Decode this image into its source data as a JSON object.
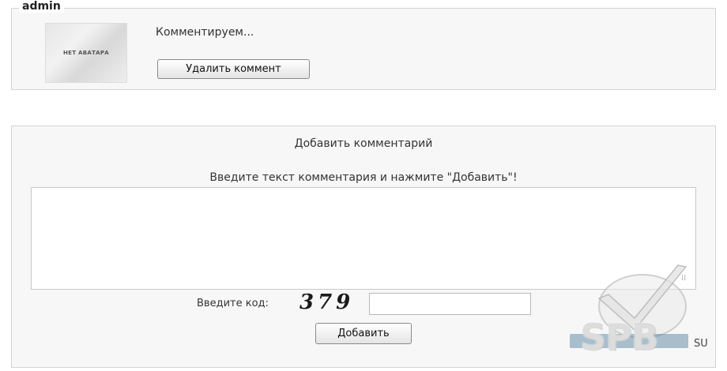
{
  "comment": {
    "author": "admin",
    "avatar_text": "НЕТ АВАТАРА",
    "text": "Комментируем...",
    "delete_label": "Удалить коммент"
  },
  "add_comment": {
    "title": "Добавить комментарий",
    "hint": "Введите текст комментария и нажмите \"Добавить\"!",
    "textarea_value": "",
    "code_label": "Введите код:",
    "captcha_code": "379",
    "code_value": "",
    "submit_label": "Добавить"
  },
  "watermark": {
    "logo_text": "SPB",
    "suffix": "SU"
  },
  "colors": {
    "panel_bg": "#f7f7f7",
    "panel_border": "#d4d4d4",
    "button_border": "#8a8a8a"
  }
}
